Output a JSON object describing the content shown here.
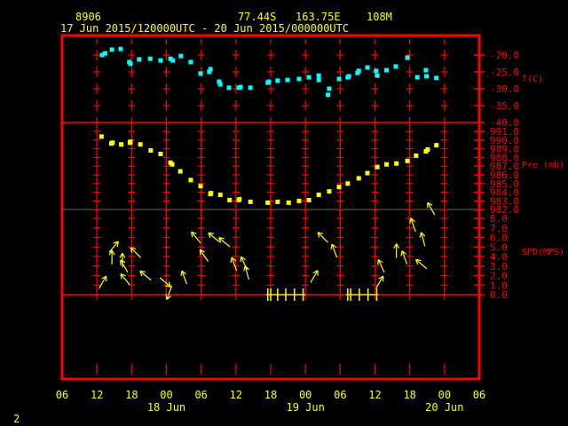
{
  "header": {
    "station": "8906",
    "lat": "77.44S",
    "lon": "163.75E",
    "elev": "108M",
    "period": "17 Jun 2015/120000UTC - 20 Jun 2015/000000UTC"
  },
  "footer": {
    "page": "2"
  },
  "colors": {
    "frame": "#ff0000",
    "temp": "#00ffff",
    "pres": "#ffff00",
    "wind": "#ffff00",
    "text": "#ffff00"
  },
  "chart_data": {
    "type": "scatter",
    "x_units": "hours since 17 Jun 2015 00 UTC",
    "xlim": [
      6,
      78
    ],
    "x_ticks": [
      {
        "h": 6,
        "label": "06"
      },
      {
        "h": 12,
        "label": "12"
      },
      {
        "h": 18,
        "label": "18"
      },
      {
        "h": 24,
        "label": "00"
      },
      {
        "h": 30,
        "label": "06"
      },
      {
        "h": 36,
        "label": "12"
      },
      {
        "h": 42,
        "label": "18"
      },
      {
        "h": 48,
        "label": "00"
      },
      {
        "h": 54,
        "label": "06"
      },
      {
        "h": 60,
        "label": "12"
      },
      {
        "h": 66,
        "label": "18"
      },
      {
        "h": 72,
        "label": "00"
      },
      {
        "h": 78,
        "label": "06"
      }
    ],
    "date_labels": [
      {
        "h": 24,
        "label": "18 Jun"
      },
      {
        "h": 48,
        "label": "19 Jun"
      },
      {
        "h": 72,
        "label": "20 Jun"
      }
    ],
    "panels": [
      {
        "name": "temperature",
        "ylabel": "T(C)",
        "ylim": [
          -40,
          -20
        ],
        "ticks": [
          "-20.0",
          "-25.0",
          "-30.0",
          "-35.0",
          "-40.0"
        ],
        "tick_values": [
          -20,
          -25,
          -30,
          -35,
          -40
        ],
        "points": [
          [
            12.9,
            -20.0
          ],
          [
            13.4,
            -19.5
          ],
          [
            14.6,
            -18.4
          ],
          [
            16.1,
            -18.2
          ],
          [
            17.6,
            -22.1
          ],
          [
            17.8,
            -22.6
          ],
          [
            19.3,
            -21.3
          ],
          [
            21.2,
            -21.1
          ],
          [
            23.0,
            -21.6
          ],
          [
            24.7,
            -21.1
          ],
          [
            25.1,
            -21.6
          ],
          [
            26.5,
            -20.3
          ],
          [
            28.2,
            -22.1
          ],
          [
            29.9,
            -25.5
          ],
          [
            31.4,
            -25.0
          ],
          [
            31.6,
            -24.2
          ],
          [
            33.1,
            -27.9
          ],
          [
            33.3,
            -28.7
          ],
          [
            34.8,
            -29.7
          ],
          [
            36.5,
            -29.7
          ],
          [
            36.8,
            -29.5
          ],
          [
            38.5,
            -29.7
          ],
          [
            41.5,
            -28.2
          ],
          [
            41.7,
            -27.9
          ],
          [
            43.2,
            -27.6
          ],
          [
            44.9,
            -27.4
          ],
          [
            46.9,
            -27.1
          ],
          [
            48.6,
            -26.6
          ],
          [
            50.3,
            -27.4
          ],
          [
            50.3,
            -26.1
          ],
          [
            51.9,
            -31.8
          ],
          [
            52.1,
            -30.0
          ],
          [
            53.8,
            -27.1
          ],
          [
            55.3,
            -26.6
          ],
          [
            55.5,
            -26.3
          ],
          [
            57.0,
            -25.3
          ],
          [
            57.2,
            -24.7
          ],
          [
            58.7,
            -23.7
          ],
          [
            60.2,
            -24.7
          ],
          [
            60.4,
            -26.1
          ],
          [
            62.0,
            -24.5
          ],
          [
            63.6,
            -23.4
          ],
          [
            65.6,
            -20.8
          ],
          [
            67.3,
            -26.6
          ],
          [
            68.8,
            -24.5
          ],
          [
            68.9,
            -26.3
          ],
          [
            70.6,
            -26.8
          ]
        ]
      },
      {
        "name": "pressure",
        "ylabel": "Pre (mb)",
        "ylim": [
          982,
          991
        ],
        "ticks": [
          "991.0",
          "990.0",
          "989.0",
          "988.0",
          "987.0",
          "986.0",
          "985.0",
          "984.0",
          "983.0",
          "982.0"
        ],
        "tick_values": [
          991,
          990,
          989,
          988,
          987,
          986,
          985,
          984,
          983,
          982
        ],
        "points": [
          [
            12.8,
            990.4
          ],
          [
            14.5,
            989.6
          ],
          [
            14.7,
            989.7
          ],
          [
            16.2,
            989.5
          ],
          [
            17.7,
            989.7
          ],
          [
            17.8,
            989.8
          ],
          [
            19.5,
            989.5
          ],
          [
            21.3,
            988.8
          ],
          [
            23.0,
            988.4
          ],
          [
            24.7,
            987.4
          ],
          [
            25.0,
            987.2
          ],
          [
            26.4,
            986.4
          ],
          [
            28.2,
            985.4
          ],
          [
            29.9,
            984.7
          ],
          [
            31.6,
            983.8
          ],
          [
            31.7,
            983.9
          ],
          [
            33.3,
            983.7
          ],
          [
            34.9,
            983.1
          ],
          [
            36.5,
            983.1
          ],
          [
            36.6,
            983.2
          ],
          [
            38.5,
            982.9
          ],
          [
            41.5,
            982.8
          ],
          [
            43.2,
            982.9
          ],
          [
            45.1,
            982.8
          ],
          [
            46.9,
            983.0
          ],
          [
            48.6,
            983.1
          ],
          [
            50.3,
            983.7
          ],
          [
            52.1,
            984.1
          ],
          [
            53.8,
            984.6
          ],
          [
            55.3,
            985.0
          ],
          [
            57.2,
            985.6
          ],
          [
            58.7,
            986.2
          ],
          [
            60.4,
            986.9
          ],
          [
            62.0,
            987.2
          ],
          [
            63.7,
            987.3
          ],
          [
            65.6,
            987.6
          ],
          [
            67.1,
            988.2
          ],
          [
            68.8,
            988.7
          ],
          [
            69.1,
            988.9
          ],
          [
            70.6,
            989.4
          ]
        ]
      },
      {
        "name": "wind",
        "ylabel": "SPD(MPS)",
        "ylim": [
          0,
          8
        ],
        "ticks": [
          "8.0",
          "7.0",
          "6.0",
          "5.0",
          "4.0",
          "3.0",
          "2.0",
          "1.0",
          "0.0"
        ],
        "tick_values": [
          8,
          7,
          6,
          5,
          4,
          3,
          2,
          1,
          0
        ],
        "arrows_note": "[hour, speed m/s, arrow pointing direction deg (0=up)]",
        "arrows": [
          [
            13.0,
            1.3,
            30
          ],
          [
            14.6,
            3.9,
            0
          ],
          [
            14.9,
            5.0,
            40
          ],
          [
            16.4,
            3.6,
            0
          ],
          [
            16.7,
            3.0,
            330
          ],
          [
            16.9,
            1.6,
            320
          ],
          [
            18.7,
            4.4,
            315
          ],
          [
            20.4,
            2.0,
            310
          ],
          [
            23.8,
            1.3,
            130
          ],
          [
            24.5,
            0.2,
            200
          ],
          [
            27.1,
            1.8,
            340
          ],
          [
            29.1,
            6.0,
            320
          ],
          [
            30.5,
            4.1,
            325
          ],
          [
            32.2,
            6.0,
            310
          ],
          [
            34.0,
            5.5,
            310
          ],
          [
            35.7,
            3.2,
            340
          ],
          [
            37.4,
            3.3,
            335
          ],
          [
            37.9,
            2.3,
            345
          ],
          [
            49.5,
            1.9,
            30
          ],
          [
            51.0,
            6.0,
            315
          ],
          [
            53.0,
            4.6,
            340
          ],
          [
            61.1,
            3.0,
            335
          ],
          [
            60.8,
            1.3,
            30
          ],
          [
            63.7,
            4.6,
            0
          ],
          [
            65.1,
            3.9,
            340
          ],
          [
            66.6,
            7.3,
            340
          ],
          [
            68.3,
            5.8,
            345
          ],
          [
            68.0,
            3.2,
            310
          ],
          [
            69.7,
            9.0,
            330
          ]
        ],
        "calm_hours": [
          41.5,
          42.0,
          43.2,
          44.6,
          46.1,
          47.6,
          55.3,
          55.8,
          57.3,
          58.8,
          60.3
        ]
      }
    ]
  }
}
